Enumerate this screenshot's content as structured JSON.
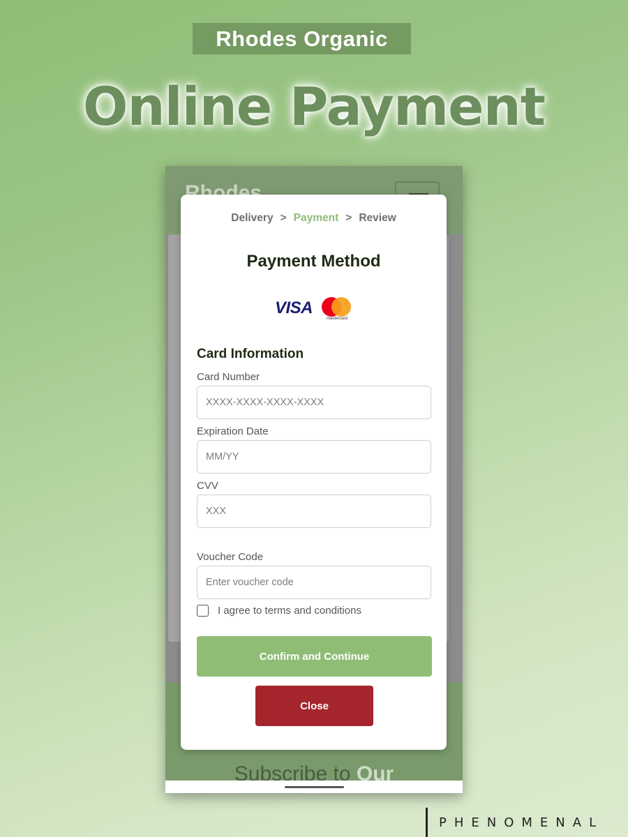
{
  "header": {
    "brand_tag": "Rhodes Organic",
    "title": "Online Payment"
  },
  "phone": {
    "brand": "Rhodes",
    "footer_text_plain": "Subscribe to",
    "footer_text_bold": "Our"
  },
  "modal": {
    "steps": [
      "Delivery",
      "Payment",
      "Review"
    ],
    "step_separator": ">",
    "active_step": "Payment",
    "title": "Payment Method",
    "card_brands": [
      "VISA",
      "mastercard"
    ],
    "section_title": "Card Information",
    "fields": {
      "card_number": {
        "label": "Card Number",
        "placeholder": "XXXX-XXXX-XXXX-XXXX"
      },
      "expiration": {
        "label": "Expiration Date",
        "placeholder": "MM/YY"
      },
      "cvv": {
        "label": "CVV",
        "placeholder": "XXX"
      },
      "voucher": {
        "label": "Voucher Code",
        "placeholder": "Enter voucher code"
      }
    },
    "terms_label": "I agree to terms and conditions",
    "confirm_label": "Confirm and Continue",
    "close_label": "Close"
  },
  "signature": "PHENOMENAL",
  "colors": {
    "accent_green": "#8fbd76",
    "close_red": "#a4262c",
    "title_green": "#6d8f5e"
  }
}
